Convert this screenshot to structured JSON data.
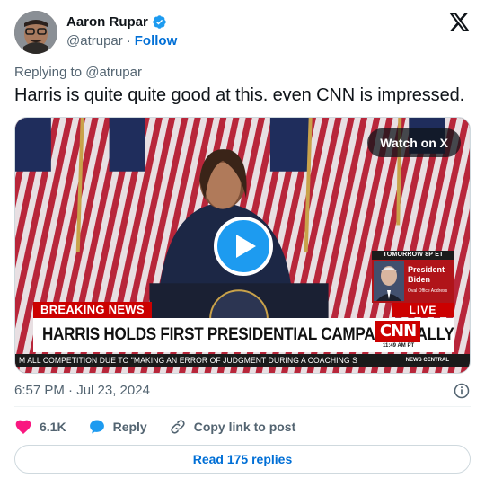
{
  "header": {
    "name": "Aaron Rupar",
    "handle": "@atrupar",
    "separator": "·",
    "follow_label": "Follow"
  },
  "reply_to": "Replying to @atrupar",
  "tweet_text": "Harris is quite quite good at this. even CNN is impressed.",
  "media": {
    "watch_label": "Watch on X",
    "cnn": {
      "upcoming_label": "TOMORROW 8P ET",
      "upcoming_name": "President Biden",
      "upcoming_sub": "Oval Office Address",
      "breaking_label": "BREAKING NEWS",
      "live_label": "LIVE",
      "headline": "HARRIS HOLDS FIRST PRESIDENTIAL CAMPAIGN RALLY",
      "network_logo": "CNN",
      "time": "11:49 AM PT",
      "ticker": "M ALL COMPETITION DUE TO \"MAKING AN ERROR OF JUDGMENT DURING A COACHING S",
      "ticker_tag": "NEWS CENTRAL"
    }
  },
  "timestamp": "6:57 PM · Jul 23, 2024",
  "actions": {
    "likes": "6.1K",
    "reply_label": "Reply",
    "copy_label": "Copy link to post"
  },
  "read_replies_label": "Read 175 replies",
  "colors": {
    "accent": "#1d9bf0",
    "link": "#006fd6",
    "like": "#f91880",
    "cnn_red": "#cc0000"
  }
}
